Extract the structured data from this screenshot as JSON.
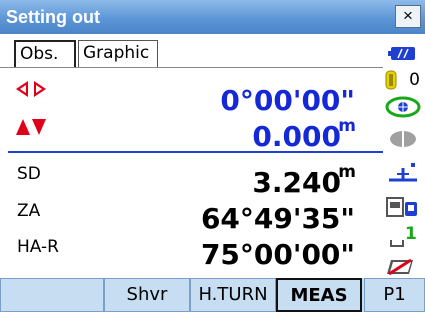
{
  "window": {
    "title": "Setting out",
    "close_label": "×"
  },
  "tabs": [
    {
      "label": "Obs."
    },
    {
      "label": "Graphic"
    }
  ],
  "observation": {
    "angle_delta": {
      "value": "0°00'00\""
    },
    "distance_delta": {
      "value": "0.000",
      "unit": "m"
    },
    "sd": {
      "label": "SD",
      "value": "3.240",
      "unit": "m"
    },
    "za": {
      "label": "ZA",
      "value": "64°49'35\""
    },
    "ha": {
      "label": "HA-R",
      "value": "75°00'00\""
    }
  },
  "status": {
    "prism_constant": "0",
    "mode_number": "1"
  },
  "softkeys": [
    {
      "label": ""
    },
    {
      "label": "Shvr"
    },
    {
      "label": "H.TURN"
    },
    {
      "label": "MEAS"
    },
    {
      "label": "P1"
    }
  ],
  "colors": {
    "title_bar": "#5d96d6",
    "value_blue": "#1428d8",
    "arrow_red": "#e0001a",
    "softkey_bg": "#c6ddf2"
  },
  "icons": [
    "left-right-arrows-icon",
    "up-down-arrows-icon",
    "battery-icon",
    "prism-icon",
    "tilt-icon",
    "laser-icon",
    "target-icon",
    "instrument-icon",
    "input-mode-icon",
    "memory-icon"
  ]
}
